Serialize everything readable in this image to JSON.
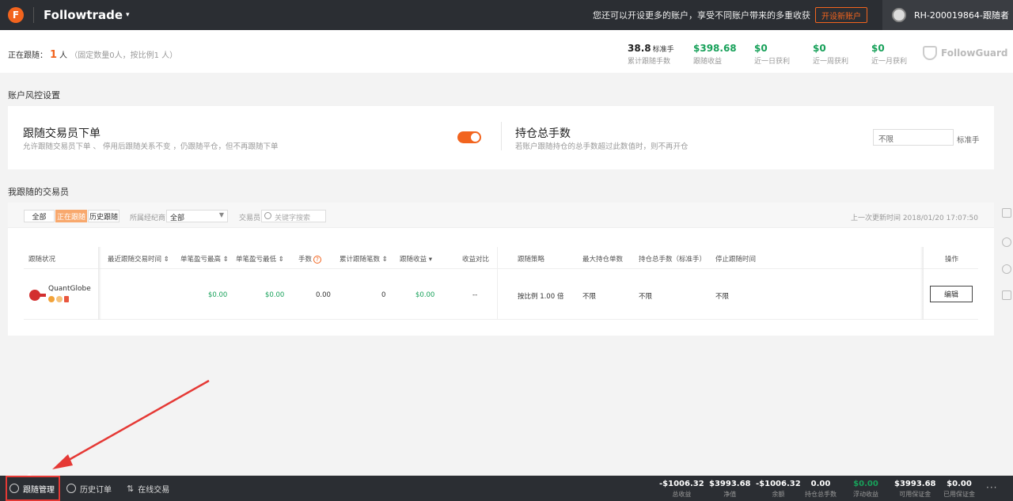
{
  "header": {
    "brand": "Followtrade",
    "promo": "您还可以开设更多的账户，享受不同账户带来的多重收获",
    "open_account": "开设新账户",
    "user": "RH-200019864-跟随者"
  },
  "stats": {
    "following_label": "正在跟随：",
    "following_count": "1",
    "following_unit": "人",
    "following_note": "（固定数量0人，按比例1 人）",
    "items": [
      {
        "value": "38.8",
        "unit": "标准手",
        "label": "累计跟随手数"
      },
      {
        "value": "$398.68",
        "label": "跟随收益"
      },
      {
        "value": "$0",
        "label": "近一日获利"
      },
      {
        "value": "$0",
        "label": "近一周获利"
      },
      {
        "value": "$0",
        "label": "近一月获利"
      }
    ],
    "followguard": "FollowGuard"
  },
  "risk": {
    "section_title": "账户风控设置",
    "follow_title": "跟随交易员下单",
    "follow_desc": "允许跟随交易员下单 、 停用后跟随关系不变 ，仍跟随平仓，但不再跟随下单",
    "follow_enabled": true,
    "lots_title": "持仓总手数",
    "lots_desc": "若账户跟随持仓的总手数超过此数值时，则不再开仓",
    "lots_value": "不限",
    "lots_unit": "标准手"
  },
  "traders": {
    "section_title": "我跟随的交易员",
    "tabs": [
      "全部",
      "正在跟随",
      "历史跟随"
    ],
    "broker_label": "所属经纪商",
    "broker_value": "全部",
    "trader_label": "交易员",
    "search_placeholder": "关键字搜索",
    "updated": "上一次更新时间 2018/01/20 17:07:50",
    "columns": [
      "跟随状况",
      "最近跟随交易时间 ⇕",
      "单笔盈亏最高 ⇕",
      "单笔盈亏最低 ⇕",
      "手数",
      "累计跟随笔数 ⇕",
      "跟随收益 ▾",
      "收益对比",
      "跟随策略",
      "最大持仓单数",
      "持仓总手数（标准手）",
      "停止跟随时间",
      "操作"
    ],
    "rows": [
      {
        "name": "QuantGlobe",
        "last_time": "",
        "max_pl": "$0.00",
        "min_pl": "$0.00",
        "lots": "0.00",
        "count": "0",
        "profit": "$0.00",
        "compare": "--",
        "strategy": "按比例 1.00 倍",
        "max_orders": "不限",
        "total_lots": "不限",
        "stop_time": "不限",
        "action": "编辑"
      }
    ]
  },
  "bottom": {
    "tabs": [
      "跟随管理",
      "历史订单",
      "在线交易"
    ],
    "stats": [
      {
        "value": "-$1006.32",
        "label": "总收益"
      },
      {
        "value": "$3993.68",
        "label": "净值"
      },
      {
        "value": "-$1006.32",
        "label": "余额"
      },
      {
        "value": "0.00",
        "label": "持仓总手数"
      },
      {
        "value": "$0.00",
        "label": "浮动收益"
      },
      {
        "value": "$3993.68",
        "label": "可用保证金"
      },
      {
        "value": "$0.00",
        "label": "已用保证金"
      }
    ],
    "more": "···"
  },
  "colors": {
    "accent": "#f2641e",
    "positive": "#18a15a",
    "annotation": "#e53935"
  }
}
